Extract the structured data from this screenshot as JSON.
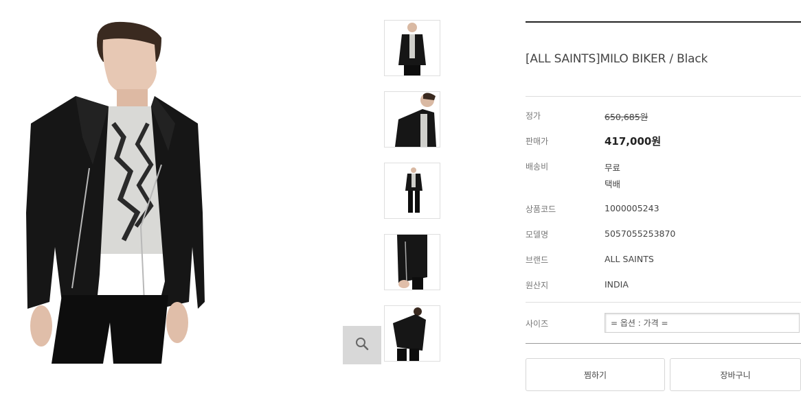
{
  "product": {
    "title": "[ALL SAINTS]MILO BIKER / Black"
  },
  "details": {
    "list_price_label": "정가",
    "list_price": "650,685원",
    "sale_price_label": "판매가",
    "sale_price": "417,000원",
    "shipping_label": "배송비",
    "shipping_fee": "무료",
    "shipping_method": "택배",
    "product_code_label": "상품코드",
    "product_code": "1000005243",
    "model_label": "모델명",
    "model": "5057055253870",
    "brand_label": "브랜드",
    "brand": "ALL SAINTS",
    "origin_label": "원산지",
    "origin": "INDIA"
  },
  "options": {
    "size_label": "사이즈",
    "size_select": "= 옵션 : 가격 ="
  },
  "actions": {
    "wishlist_label": "찜하기",
    "cart_label": "장바구니"
  },
  "icons": {
    "zoom": "magnifier-icon"
  },
  "colors": {
    "jacket": "#1a1a1a",
    "accent_rule": "#222222"
  }
}
